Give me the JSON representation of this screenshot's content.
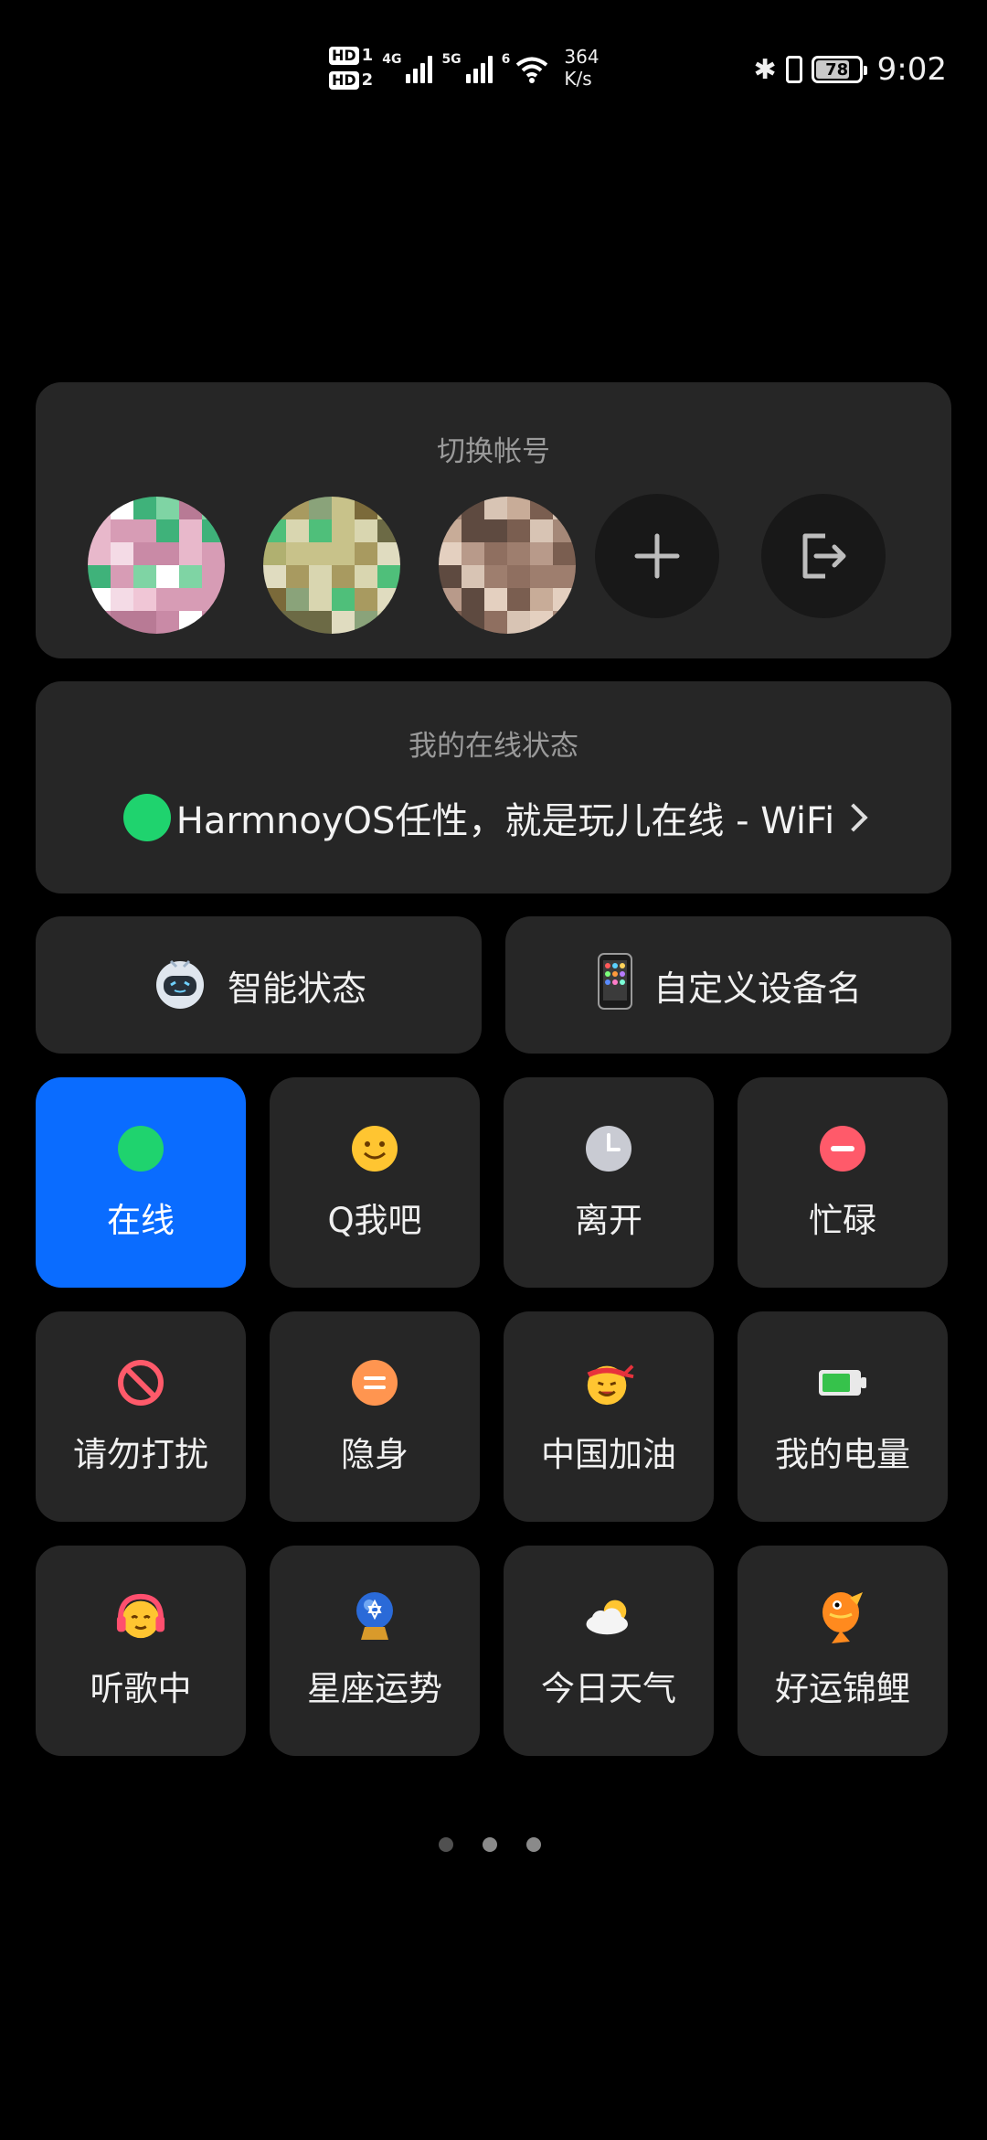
{
  "status_bar": {
    "sim1_label": "HD",
    "sim1_index": "1",
    "sim2_label": "HD",
    "sim2_index": "2",
    "net1": "4G",
    "net2": "5G",
    "wifi": "6",
    "speed_value": "364",
    "speed_unit": "K/s",
    "battery": "78",
    "time": "9:02"
  },
  "accounts": {
    "title": "切换帐号",
    "avatars": [
      "avatar-1",
      "avatar-2",
      "avatar-3"
    ],
    "add_icon": "plus-icon",
    "logout_icon": "logout-icon"
  },
  "online_status": {
    "title": "我的在线状态",
    "status_text": "HarmnoyOS任性，就是玩儿在线 - WiFi"
  },
  "quick_actions": [
    {
      "label": "智能状态",
      "icon": "robot-icon"
    },
    {
      "label": "自定义设备名",
      "icon": "phone-icon"
    }
  ],
  "status_tiles": [
    {
      "label": "在线",
      "icon": "green-dot-icon",
      "selected": true
    },
    {
      "label": "Q我吧",
      "icon": "smile-icon"
    },
    {
      "label": "离开",
      "icon": "clock-icon"
    },
    {
      "label": "忙碌",
      "icon": "busy-icon"
    },
    {
      "label": "请勿打扰",
      "icon": "no-entry-icon"
    },
    {
      "label": "隐身",
      "icon": "invisible-icon"
    },
    {
      "label": "中国加油",
      "icon": "cheer-icon"
    },
    {
      "label": "我的电量",
      "icon": "battery-icon"
    },
    {
      "label": "听歌中",
      "icon": "headphones-icon"
    },
    {
      "label": "星座运势",
      "icon": "crystal-ball-icon"
    },
    {
      "label": "今日天气",
      "icon": "weather-icon"
    },
    {
      "label": "好运锦鲤",
      "icon": "koi-icon"
    }
  ],
  "pager": {
    "pages": 3,
    "current": 1
  },
  "colors": {
    "accent": "#0a6cff",
    "online_green": "#1fd36e",
    "card": "#262626"
  }
}
